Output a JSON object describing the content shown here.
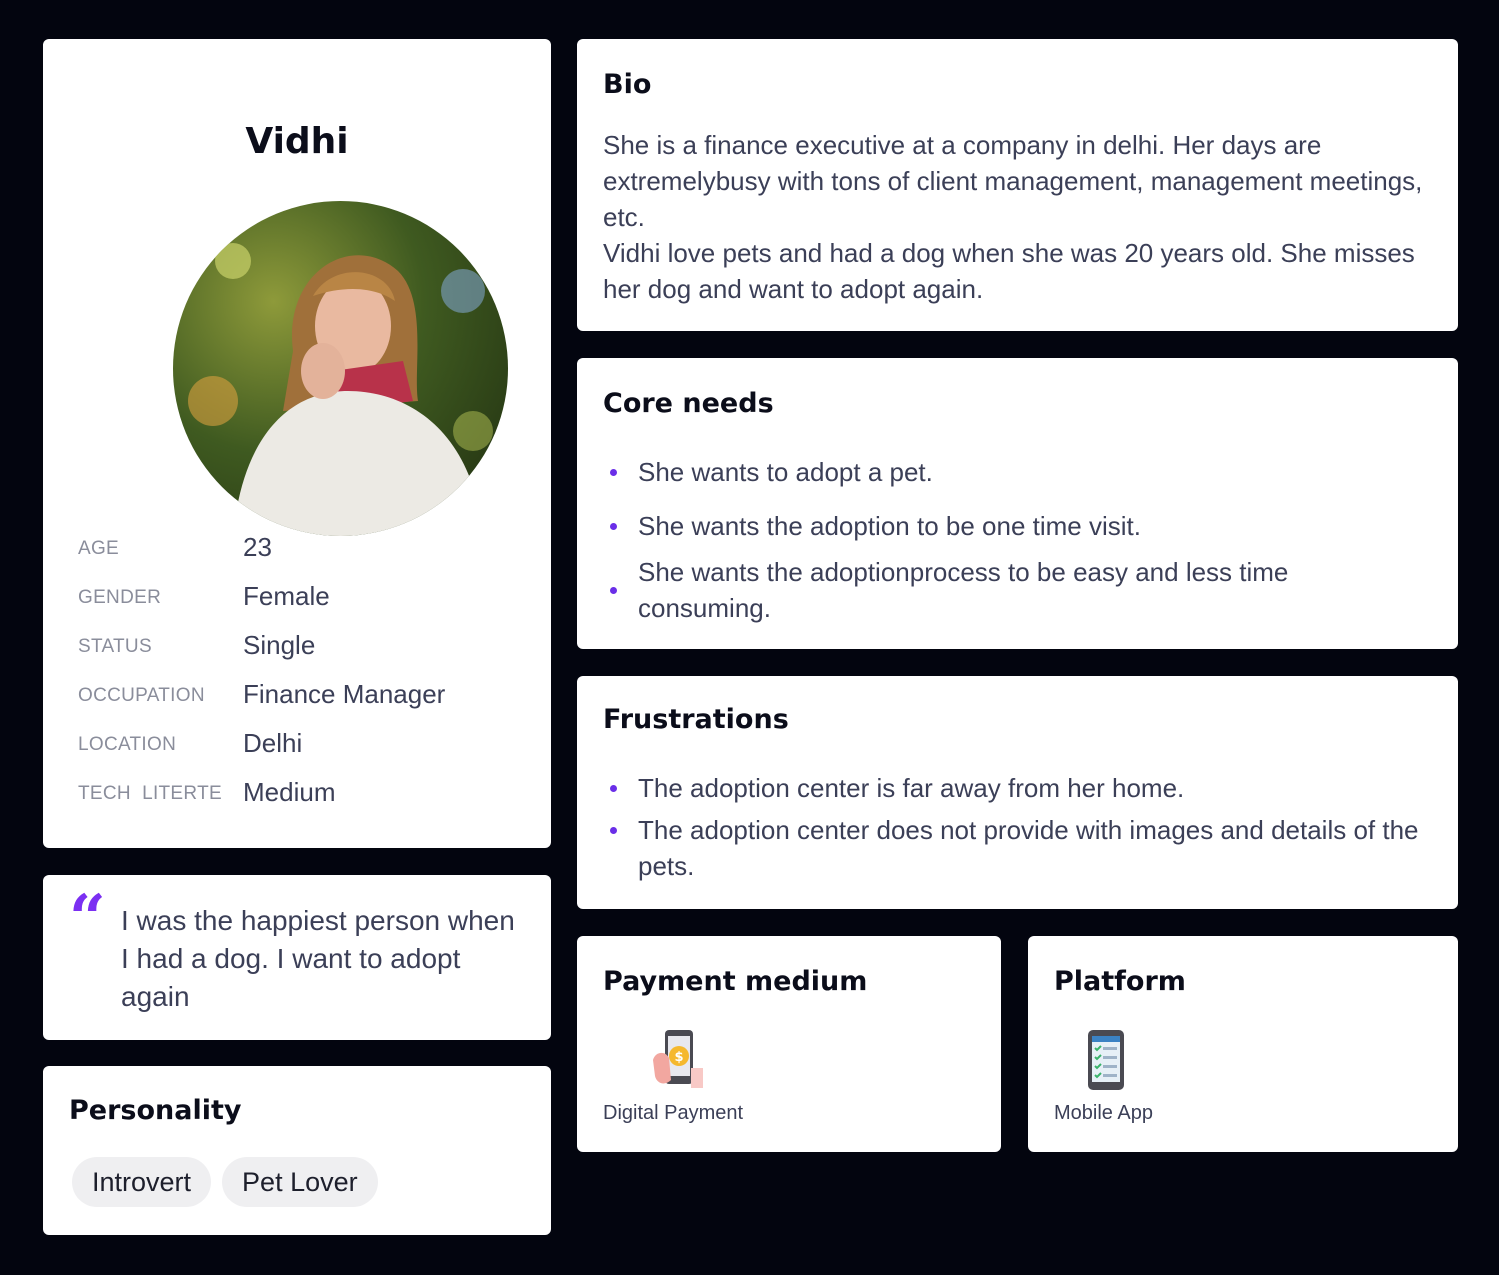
{
  "profile": {
    "name": "Vidhi",
    "attributes": [
      {
        "label": "AGE",
        "value": "23"
      },
      {
        "label": "GENDER",
        "value": "Female"
      },
      {
        "label": "STATUS",
        "value": "Single"
      },
      {
        "label": "OCCUPATION",
        "value": "Finance Manager"
      },
      {
        "label": "LOCATION",
        "value": "Delhi"
      },
      {
        "label": "TECH  LITERTE",
        "value": "Medium"
      }
    ]
  },
  "quote": {
    "mark": "“",
    "text": "I was the happiest person when I had a dog. I want to adopt again"
  },
  "personality": {
    "title": "Personality",
    "traits": [
      "Introvert",
      "Pet Lover"
    ]
  },
  "bio": {
    "title": "Bio",
    "paragraphs": [
      "She is a finance executive at a company in delhi. Her days are extremelybusy with tons of client management, management meetings, etc.",
      "Vidhi love pets and had a dog when she was 20 years old. She misses her dog and want to adopt again."
    ]
  },
  "core_needs": {
    "title": "Core needs",
    "items": [
      "She wants to adopt a pet.",
      "She wants the adoption to be one time visit.",
      "She wants the adoptionprocess to be easy and less time consuming."
    ]
  },
  "frustrations": {
    "title": "Frustrations",
    "items": [
      "The adoption center is far away from her home.",
      "The adoption center does not provide with images and details of the pets."
    ]
  },
  "payment": {
    "title": "Payment medium",
    "label": "Digital Payment",
    "icon": "digital-payment-icon"
  },
  "platform": {
    "title": "Platform",
    "label": "Mobile App",
    "icon": "mobile-app-icon"
  },
  "colors": {
    "background": "#03050f",
    "card": "#ffffff",
    "accent": "#7b2ff2",
    "text": "#3b3f57",
    "label": "#8a8d9b",
    "chip": "#efeff1"
  }
}
